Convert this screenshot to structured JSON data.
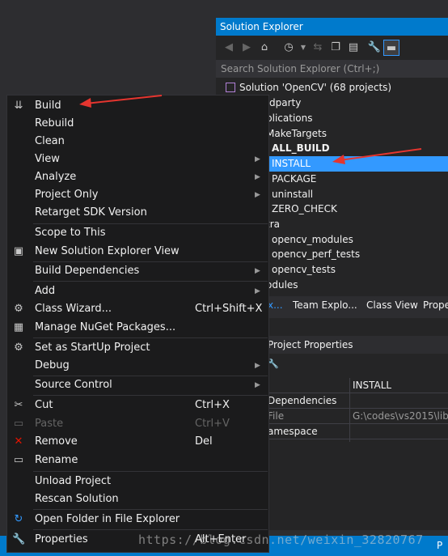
{
  "solution_explorer": {
    "title": "Solution Explorer",
    "search_placeholder": "Search Solution Explorer (Ctrl+;)",
    "tree": [
      {
        "label": "Solution 'OpenCV' (68 projects)"
      },
      {
        "label": "dparty"
      },
      {
        "label": "plications"
      },
      {
        "label": "MakeTargets"
      },
      {
        "label": "ALL_BUILD"
      },
      {
        "label": "INSTALL"
      },
      {
        "label": "PACKAGE"
      },
      {
        "label": "uninstall"
      },
      {
        "label": "ZERO_CHECK"
      },
      {
        "label": "tra"
      },
      {
        "label": "opencv_modules"
      },
      {
        "label": "opencv_perf_tests"
      },
      {
        "label": "opencv_tests"
      },
      {
        "label": "odules"
      }
    ],
    "tabs": [
      "x...",
      "Team Explo...",
      "Class View",
      "Prope"
    ]
  },
  "properties": {
    "title": "Project Properties",
    "rows": [
      {
        "key": "",
        "value": "INSTALL"
      },
      {
        "key": "Dependencies",
        "value": ""
      },
      {
        "key": "File",
        "value": "G:\\codes\\vs2015\\libr"
      },
      {
        "key": "amespace",
        "value": ""
      }
    ]
  },
  "context_menu": {
    "items": {
      "build": {
        "label": "Build"
      },
      "rebuild": {
        "label": "Rebuild"
      },
      "clean": {
        "label": "Clean"
      },
      "view": {
        "label": "View"
      },
      "analyze": {
        "label": "Analyze"
      },
      "project_only": {
        "label": "Project Only"
      },
      "retarget": {
        "label": "Retarget SDK Version"
      },
      "scope": {
        "label": "Scope to This"
      },
      "new_se_view": {
        "label": "New Solution Explorer View"
      },
      "build_deps": {
        "label": "Build Dependencies"
      },
      "add": {
        "label": "Add"
      },
      "class_wizard": {
        "label": "Class Wizard...",
        "shortcut": "Ctrl+Shift+X"
      },
      "nuget": {
        "label": "Manage NuGet Packages..."
      },
      "startup": {
        "label": "Set as StartUp Project"
      },
      "debug": {
        "label": "Debug"
      },
      "source_control": {
        "label": "Source Control"
      },
      "cut": {
        "label": "Cut",
        "shortcut": "Ctrl+X"
      },
      "paste": {
        "label": "Paste",
        "shortcut": "Ctrl+V"
      },
      "remove": {
        "label": "Remove",
        "shortcut": "Del"
      },
      "rename": {
        "label": "Rename"
      },
      "unload": {
        "label": "Unload Project"
      },
      "rescan": {
        "label": "Rescan Solution"
      },
      "open_folder": {
        "label": "Open Folder in File Explorer"
      },
      "properties": {
        "label": "Properties",
        "shortcut": "Alt+Enter"
      }
    }
  },
  "status_bar": {
    "right_text": "P"
  },
  "watermark": "https://blog.csdn.net/weixin_32820767",
  "colors": {
    "accent": "#007acc",
    "selection": "#3399ff",
    "annotation_arrow": "#e5352f",
    "remove_icon": "#e51400"
  }
}
